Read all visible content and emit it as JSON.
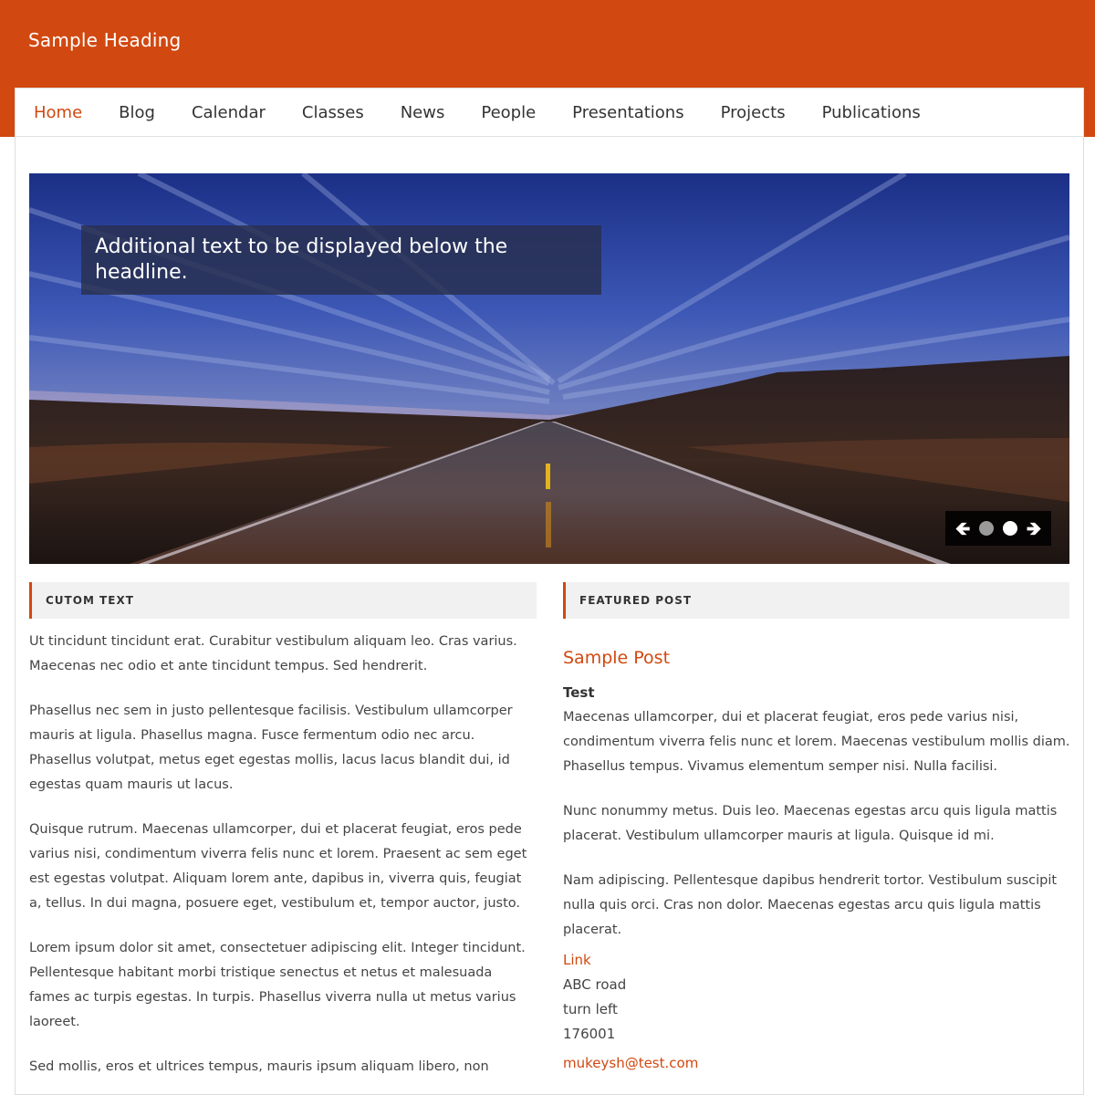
{
  "header": {
    "site_title": "Sample Heading",
    "brand_color": "#d14810"
  },
  "nav": {
    "items": [
      {
        "label": "Home",
        "active": true
      },
      {
        "label": "Blog"
      },
      {
        "label": "Calendar"
      },
      {
        "label": "Classes"
      },
      {
        "label": "News"
      },
      {
        "label": "People"
      },
      {
        "label": "Presentations"
      },
      {
        "label": "Projects"
      },
      {
        "label": "Publications"
      }
    ]
  },
  "slider": {
    "caption": "Additional text to be displayed below the headline.",
    "prev_icon": "arrow-left-icon",
    "next_icon": "arrow-right-icon",
    "slides_count": 2,
    "active_slide": 2
  },
  "custom_text": {
    "heading": "CUTOM TEXT",
    "paragraphs": [
      "Ut tincidunt tincidunt erat. Curabitur vestibulum aliquam leo. Cras varius. Maecenas nec odio et ante tincidunt tempus. Sed hendrerit.",
      "Phasellus nec sem in justo pellentesque facilisis. Vestibulum ullamcorper mauris at ligula. Phasellus magna. Fusce fermentum odio nec arcu. Phasellus volutpat, metus eget egestas mollis, lacus lacus blandit dui, id egestas quam mauris ut lacus.",
      "Quisque rutrum. Maecenas ullamcorper, dui et placerat feugiat, eros pede varius nisi, condimentum viverra felis nunc et lorem. Praesent ac sem eget est egestas volutpat. Aliquam lorem ante, dapibus in, viverra quis, feugiat a, tellus. In dui magna, posuere eget, vestibulum et, tempor auctor, justo.",
      "Lorem ipsum dolor sit amet, consectetuer adipiscing elit. Integer tincidunt. Pellentesque habitant morbi tristique senectus et netus et malesuada fames ac turpis egestas. In turpis. Phasellus viverra nulla ut metus varius laoreet.",
      "Sed mollis, eros et ultrices tempus, mauris ipsum aliquam libero, non"
    ]
  },
  "featured_post": {
    "heading": "FEATURED POST",
    "title": "Sample Post",
    "subtitle": "Test",
    "paragraphs": [
      "Maecenas ullamcorper, dui et placerat feugiat, eros pede varius nisi, condimentum viverra felis nunc et lorem. Maecenas vestibulum mollis diam. Phasellus tempus. Vivamus elementum semper nisi. Nulla facilisi.",
      "Nunc nonummy metus. Duis leo. Maecenas egestas arcu quis ligula mattis placerat. Vestibulum ullamcorper mauris at ligula. Quisque id mi.",
      "Nam adipiscing. Pellentesque dapibus hendrerit tortor. Vestibulum suscipit nulla quis orci. Cras non dolor. Maecenas egestas arcu quis ligula mattis placerat."
    ],
    "link_label": "Link",
    "address_lines": [
      "ABC road",
      "turn left",
      "176001"
    ],
    "email": "mukeysh@test.com"
  }
}
